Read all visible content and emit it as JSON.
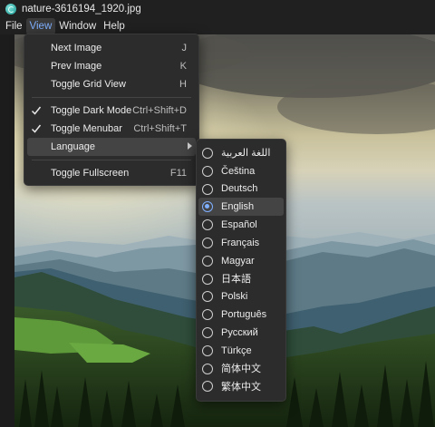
{
  "window": {
    "title": "nature-3616194_1920.jpg"
  },
  "menubar": {
    "items": [
      "File",
      "View",
      "Window",
      "Help"
    ],
    "active_index": 1
  },
  "view_menu": {
    "items": [
      {
        "label": "Next Image",
        "shortcut": "J",
        "checked": false
      },
      {
        "label": "Prev Image",
        "shortcut": "K",
        "checked": false
      },
      {
        "label": "Toggle Grid View",
        "shortcut": "H",
        "checked": false
      },
      {
        "label": "Toggle Dark Mode",
        "shortcut": "Ctrl+Shift+D",
        "checked": true
      },
      {
        "label": "Toggle Menubar",
        "shortcut": "Ctrl+Shift+T",
        "checked": true
      },
      {
        "label": "Language",
        "shortcut": "",
        "checked": false,
        "submenu": true
      },
      {
        "label": "Toggle Fullscreen",
        "shortcut": "F11",
        "checked": false
      }
    ]
  },
  "language_menu": {
    "items": [
      "اللغة العربية",
      "Čeština",
      "Deutsch",
      "English",
      "Español",
      "Français",
      "Magyar",
      "日本語",
      "Polski",
      "Português",
      "Русский",
      "Türkçe",
      "简体中文",
      "繁体中文"
    ],
    "selected": "English"
  },
  "colors": {
    "accent": "#7fb0ff",
    "menu_bg": "#2c2c2c",
    "titlebar_bg": "#202020"
  }
}
